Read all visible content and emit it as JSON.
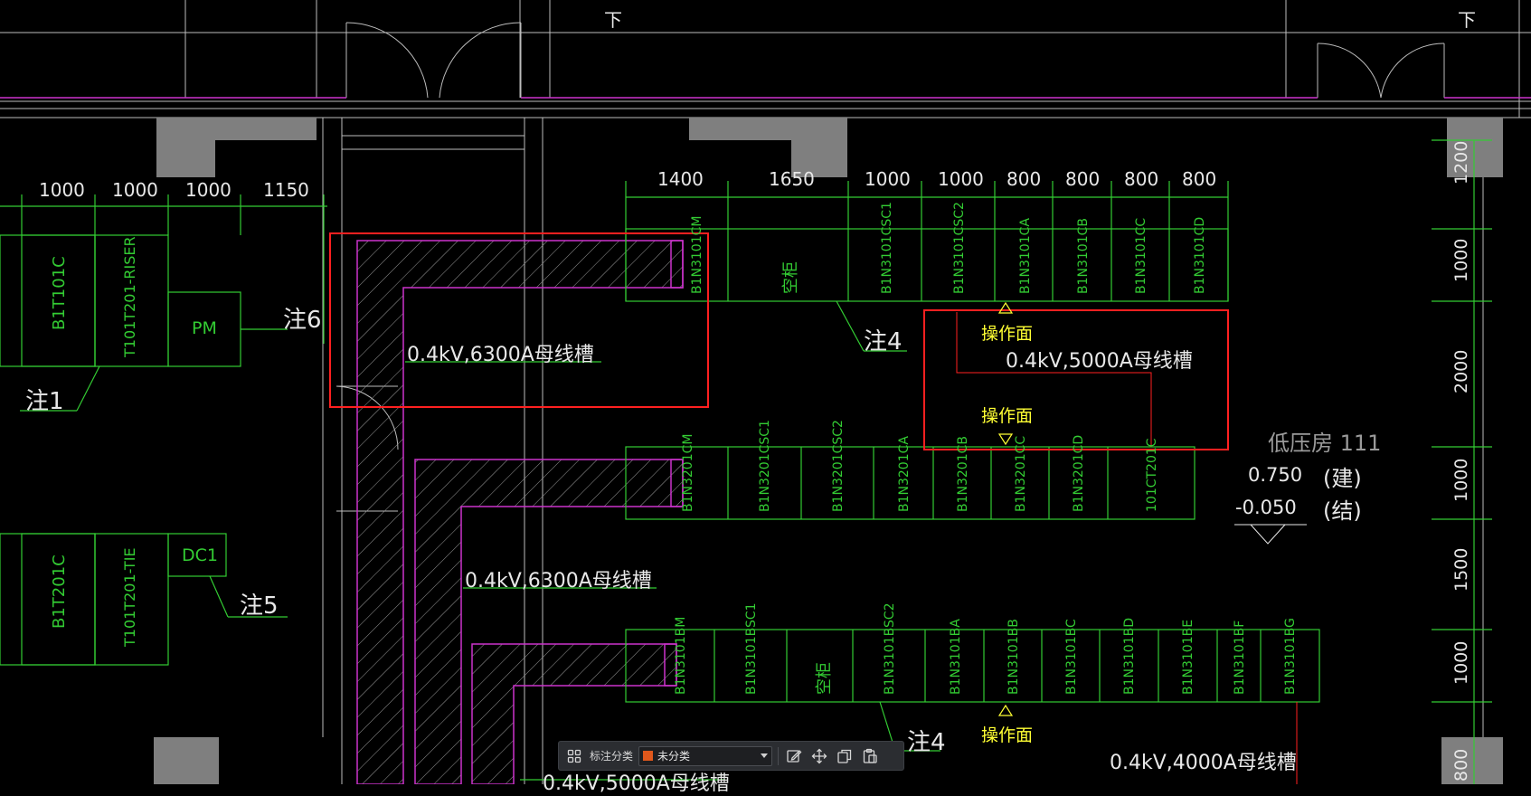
{
  "drawing": {
    "door_marks": [
      "下",
      "下"
    ],
    "dims_top_left": [
      "1000",
      "1000",
      "1000",
      "1150"
    ],
    "dims_top_right": [
      "1400",
      "1650",
      "1000",
      "1000",
      "800",
      "800",
      "800",
      "800"
    ],
    "dims_right": [
      "1200",
      "1000",
      "2000",
      "1000",
      "1500",
      "1000",
      "800"
    ],
    "left_panels_upper": [
      "B1T101C",
      "T101T201-RISER",
      "PM"
    ],
    "left_panels_lower": [
      "B1T201C",
      "T101T201-TIE",
      "DC1"
    ],
    "row1_panels": [
      "B1N3101CM",
      "空柜",
      "B1N3101CSC1",
      "B1N3101CSC2",
      "B1N3101CA",
      "B1N3101CB",
      "B1N3101CC",
      "B1N3101CD"
    ],
    "row2_panels": [
      "B1N3201CM",
      "B1N3201CSC1",
      "B1N3201CSC2",
      "B1N3201CA",
      "B1N3201CB",
      "B1N3201CC",
      "B1N3201CD",
      "101CT201C"
    ],
    "row3_panels": [
      "B1N3101BM",
      "B1N3101BSC1",
      "空柜",
      "B1N3101BSC2",
      "B1N3101BA",
      "B1N3101BB",
      "B1N3101BC",
      "B1N3101BD",
      "B1N3101BE",
      "B1N3101BF",
      "B1N3101BG"
    ],
    "notes": {
      "note1": "注1",
      "note4a": "注4",
      "note4b": "注4",
      "note5": "注5",
      "note6": "注6"
    },
    "busbars": {
      "b6300a": "0.4kV,6300A母线槽",
      "b6300b": "0.4kV,6300A母线槽",
      "b5000": "0.4kV,5000A母线槽",
      "b4000": "0.4kV,4000A母线槽",
      "b5000_bottom": "0.4kV,5000A母线槽"
    },
    "op_face": [
      "操作面",
      "操作面",
      "操作面"
    ],
    "room": {
      "name": "低压房 111",
      "elev_arch": "0.750",
      "elev_arch_tag": "(建)",
      "elev_struct": "-0.050",
      "elev_struct_tag": "(结)"
    }
  },
  "toolbar": {
    "label": "标注分类",
    "category_value": "未分类",
    "category_color": "#e0581c"
  },
  "colors": {
    "green": "#33cc33",
    "magenta": "#cc33cc",
    "red": "#ff2020",
    "yellow": "#ffff33",
    "white": "#e8e8e8",
    "gray": "#808080"
  }
}
